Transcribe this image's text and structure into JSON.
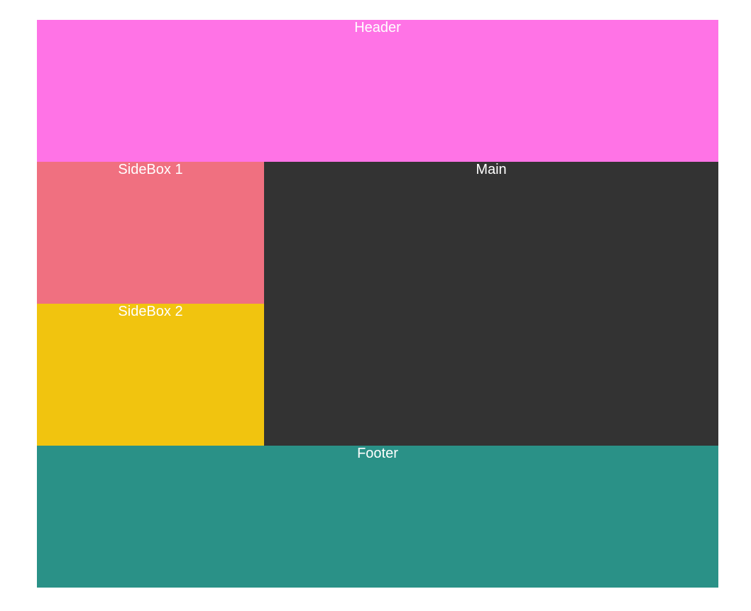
{
  "layout": {
    "header": {
      "label": "Header",
      "color": "#ff73e6"
    },
    "sidebox1": {
      "label": "SideBox 1",
      "color": "#f07080"
    },
    "sidebox2": {
      "label": "SideBox 2",
      "color": "#f1c40f"
    },
    "main": {
      "label": "Main",
      "color": "#333333"
    },
    "footer": {
      "label": "Footer",
      "color": "#2a9187"
    }
  }
}
